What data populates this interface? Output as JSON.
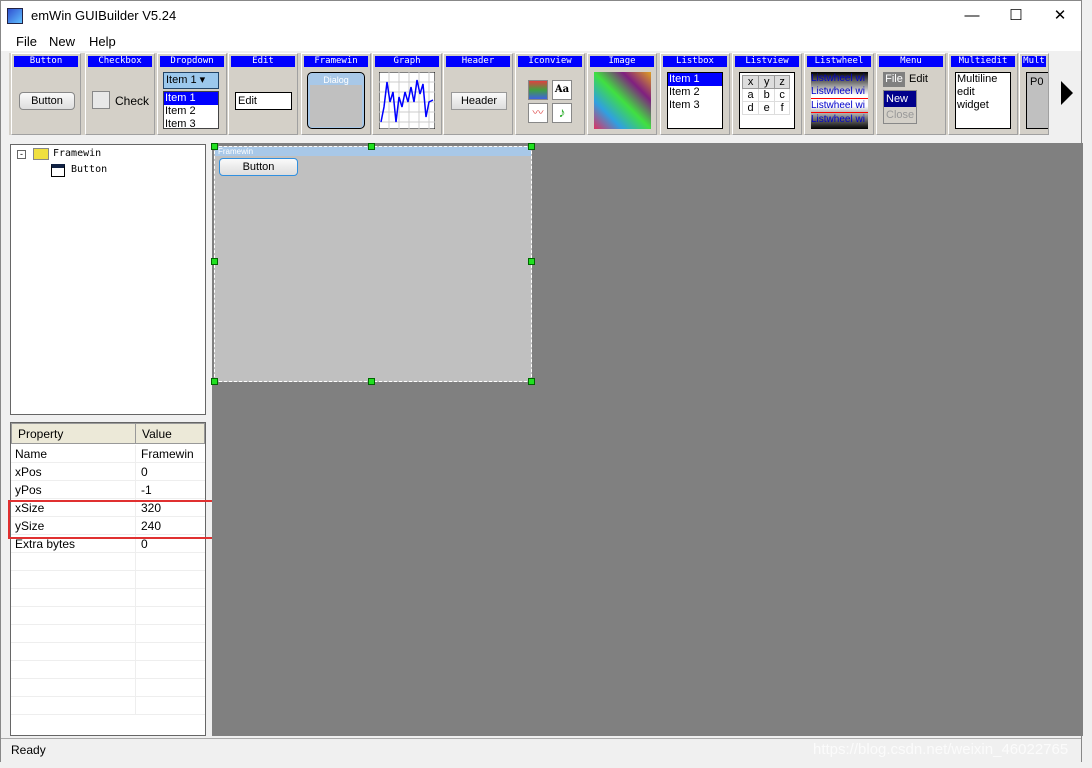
{
  "window": {
    "title": "emWin GUIBuilder V5.24",
    "controls": [
      "—",
      "☐",
      "✕"
    ]
  },
  "menu": [
    "File",
    "New",
    "Help"
  ],
  "toolbar": {
    "items": [
      {
        "label": "Button",
        "sample": "Button"
      },
      {
        "label": "Checkbox",
        "sample": "Check"
      },
      {
        "label": "Dropdown",
        "sample": "Item 1",
        "list": [
          "Item 1",
          "Item 2",
          "Item 3"
        ]
      },
      {
        "label": "Edit",
        "sample": "Edit"
      },
      {
        "label": "Framewin",
        "sample": "Dialog"
      },
      {
        "label": "Graph"
      },
      {
        "label": "Header",
        "sample": "Header"
      },
      {
        "label": "Iconview",
        "sample": "Aa"
      },
      {
        "label": "Image"
      },
      {
        "label": "Listbox",
        "list": [
          "Item 1",
          "Item 2",
          "Item 3"
        ]
      },
      {
        "label": "Listview",
        "cols": [
          "x",
          "y",
          "z"
        ],
        "rows": [
          [
            "a",
            "b",
            "c"
          ],
          [
            "d",
            "e",
            "f"
          ]
        ]
      },
      {
        "label": "Listwheel",
        "sample": "Listwheel wi"
      },
      {
        "label": "Menu",
        "items": [
          "File",
          "Edit"
        ],
        "sub": [
          "New",
          "Close"
        ]
      },
      {
        "label": "Multiedit",
        "lines": [
          "Multiline",
          "edit",
          "widget"
        ]
      },
      {
        "label": "Mult",
        "sample": "P0"
      }
    ]
  },
  "tree": {
    "root": "Framewin",
    "child": "Button"
  },
  "properties": {
    "headers": [
      "Property",
      "Value"
    ],
    "rows": [
      [
        "Name",
        "Framewin"
      ],
      [
        "xPos",
        "0"
      ],
      [
        "yPos",
        "-1"
      ],
      [
        "xSize",
        "320"
      ],
      [
        "ySize",
        "240"
      ],
      [
        "Extra bytes",
        "0"
      ]
    ]
  },
  "canvas": {
    "framewin_title": "Framewin",
    "button_label": "Button"
  },
  "status": "Ready",
  "watermark": "https://blog.csdn.net/weixin_46022765",
  "colors": {
    "accent": "#0000ff",
    "highlight": "#e03030",
    "canvas": "#808080"
  }
}
